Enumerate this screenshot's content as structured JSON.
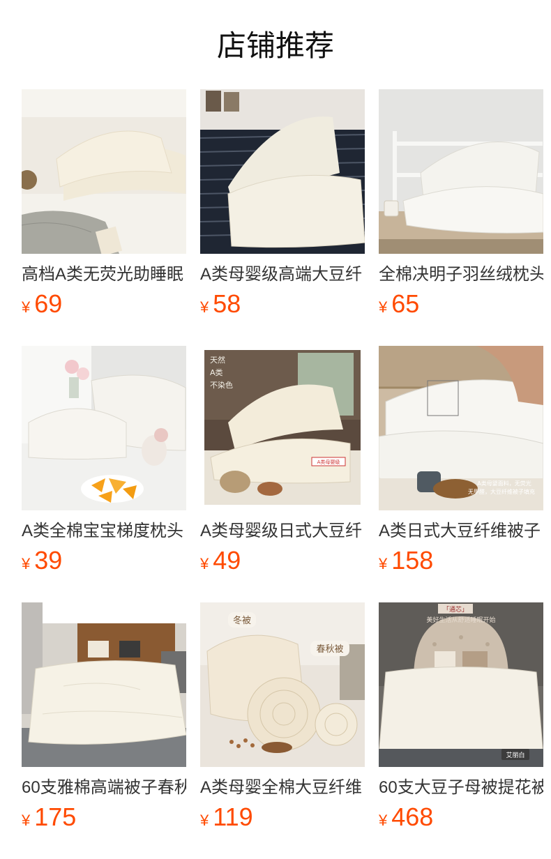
{
  "header": {
    "title": "店铺推荐"
  },
  "products": [
    {
      "name": "高档A类无荧光助睡眠",
      "currency": "¥",
      "price": "69",
      "image": "pillow-beige-bedroom-photo"
    },
    {
      "name": "A类母婴级高端大豆纤",
      "currency": "¥",
      "price": "58",
      "image": "pillow-satin-sofa-photo"
    },
    {
      "name": "全棉决明子羽丝绒枕头",
      "currency": "¥",
      "price": "65",
      "image": "pillow-wood-shelf-photo"
    },
    {
      "name": "A类全棉宝宝梯度枕头",
      "currency": "¥",
      "price": "39",
      "image": "pillow-kids-flowers-photo"
    },
    {
      "name": "A类母婴级日式大豆纤",
      "currency": "¥",
      "price": "49",
      "image": "pillow-soybean-photo"
    },
    {
      "name": "A类日式大豆纤维被子",
      "currency": "¥",
      "price": "158",
      "image": "quilt-hand-press-photo"
    },
    {
      "name": "60支雅棉高端被子春秋",
      "currency": "¥",
      "price": "175",
      "image": "quilt-bed-photo"
    },
    {
      "name": "A类母婴全棉大豆纤维",
      "currency": "¥",
      "price": "119",
      "image": "quilt-rolls-photo"
    },
    {
      "name": "60支大豆子母被提花被",
      "currency": "¥",
      "price": "468",
      "image": "quilt-tufted-headboard-photo"
    }
  ],
  "overlay_text": {
    "p5_tag1": "天然",
    "p5_tag2": "A类",
    "p5_tag3": "不染色",
    "p5_label": "A类母婴级",
    "p6_note1": "A类母婴面料，无荧光",
    "p6_note2": "无甲醛，大豆纤维被子填充",
    "p8_tag_winter": "冬被",
    "p8_tag_spring": "春秋被",
    "p9_tag_top": "「通芯」",
    "p9_script": "美好生活从舒适睡眠开始",
    "p9_badge": "艾丽白"
  },
  "colors": {
    "price": "#ff4a00",
    "title": "#111111",
    "name": "#333333"
  }
}
